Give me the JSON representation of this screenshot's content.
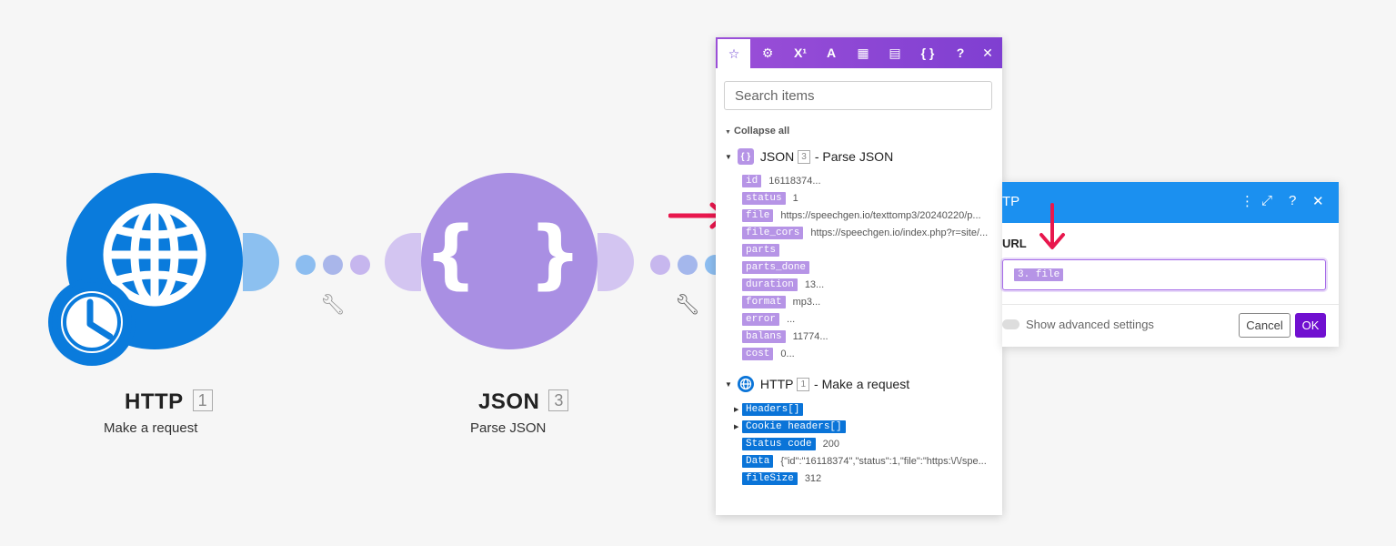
{
  "colors": {
    "http_blue": "#0a7bdc",
    "json_purple": "#a98fe3",
    "toolbar_purple": "#8a45d4",
    "dialog_blue": "#1b90f0",
    "pill_purple": "#b694e6",
    "pill_blue": "#0a74d8",
    "ok_purple": "#7010d0",
    "arrow_red": "#e8174d"
  },
  "modules": [
    {
      "title": "HTTP",
      "number": "1",
      "subtitle": "Make a request",
      "icon": "globe-clock-icon"
    },
    {
      "title": "JSON",
      "number": "3",
      "subtitle": "Parse JSON",
      "icon": "braces-icon",
      "glyph": "{ }"
    }
  ],
  "mapping_panel": {
    "toolbar": [
      {
        "icon": "star-icon",
        "glyph": "☆",
        "active": true
      },
      {
        "icon": "gear-icon",
        "glyph": "⚙"
      },
      {
        "icon": "superscript-icon",
        "glyph": "X¹"
      },
      {
        "icon": "text-icon",
        "glyph": "A"
      },
      {
        "icon": "calendar-icon",
        "glyph": "▦"
      },
      {
        "icon": "table-icon",
        "glyph": "▤"
      },
      {
        "icon": "braces-icon",
        "glyph": "{ }"
      },
      {
        "icon": "help-icon",
        "glyph": "?"
      },
      {
        "icon": "close-icon",
        "glyph": "✕"
      }
    ],
    "search_placeholder": "Search items",
    "collapse_label": "Collapse all",
    "json_group": {
      "name": "JSON",
      "number": "3",
      "label": "- Parse JSON",
      "icon_glyph": "{ }",
      "items": [
        {
          "key": "id",
          "value": "16118374..."
        },
        {
          "key": "status",
          "value": "1"
        },
        {
          "key": "file",
          "value": "https://speechgen.io/texttomp3/20240220/p..."
        },
        {
          "key": "file_cors",
          "value": "https://speechgen.io/index.php?r=site/..."
        },
        {
          "key": "parts",
          "value": ""
        },
        {
          "key": "parts_done",
          "value": ""
        },
        {
          "key": "duration",
          "value": "13..."
        },
        {
          "key": "format",
          "value": "mp3..."
        },
        {
          "key": "error",
          "value": "..."
        },
        {
          "key": "balans",
          "value": "11774..."
        },
        {
          "key": "cost",
          "value": "0..."
        }
      ]
    },
    "http_group": {
      "name": "HTTP",
      "number": "1",
      "label": "- Make a request",
      "items": [
        {
          "key": "Headers[]",
          "value": "",
          "expandable": true
        },
        {
          "key": "Cookie headers[]",
          "value": "",
          "expandable": true
        },
        {
          "key": "Status code",
          "value": "200"
        },
        {
          "key": "Data",
          "value": "{\"id\":\"16118374\",\"status\":1,\"file\":\"https:\\/\\/spe..."
        },
        {
          "key": "fileSize",
          "value": "312"
        }
      ]
    }
  },
  "http_dialog": {
    "title": "TP",
    "url_label": "URL",
    "url_value_pill": "3. file",
    "advanced_label": "Show advanced settings",
    "cancel_label": "Cancel",
    "ok_label": "OK",
    "header_icons": [
      "more-vertical-icon",
      "expand-icon",
      "help-icon",
      "close-icon"
    ]
  }
}
